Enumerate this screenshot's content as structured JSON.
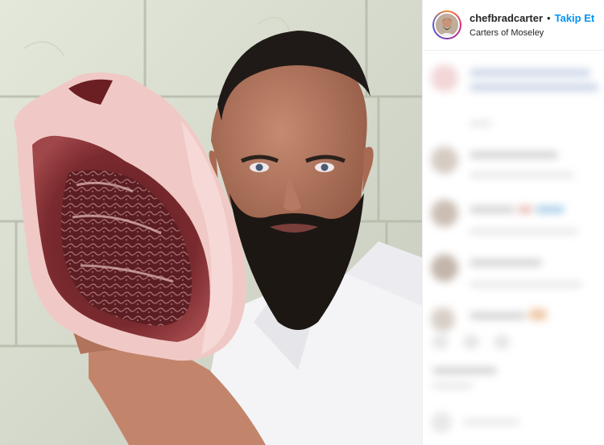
{
  "post": {
    "username": "chefbradcarter",
    "separator": "•",
    "follow_label": "Takip Et",
    "location": "Carters of Moseley"
  },
  "icons": {
    "avatar": "profile-avatar",
    "comments": "blurred-comment-avatars"
  },
  "colors": {
    "follow": "#0095f6",
    "text": "#262626",
    "divider": "#efefef"
  }
}
